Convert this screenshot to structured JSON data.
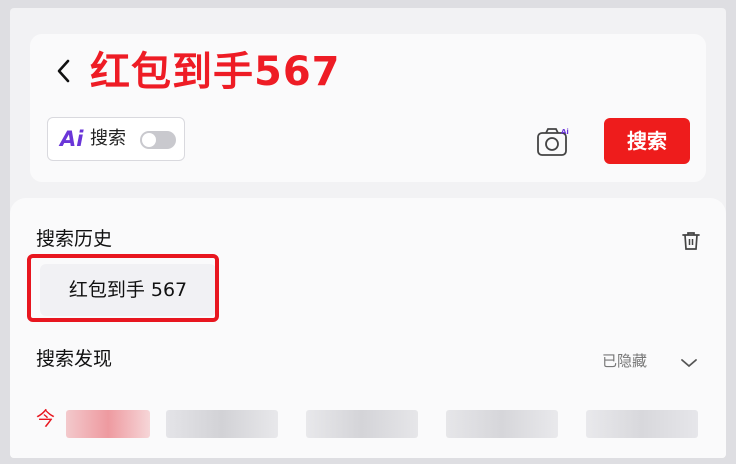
{
  "search": {
    "query": "红包到手567",
    "ai_logo": "Ai",
    "ai_label": "搜索",
    "ai_toggle_on": false,
    "submit_label": "搜索"
  },
  "history": {
    "title": "搜索历史",
    "items": [
      "红包到手 567"
    ]
  },
  "discover": {
    "title": "搜索发现",
    "hidden_label": "已隐藏",
    "first_tab": "今"
  },
  "colors": {
    "accent": "#ee1c25",
    "ai_purple": "#6a35d8"
  }
}
